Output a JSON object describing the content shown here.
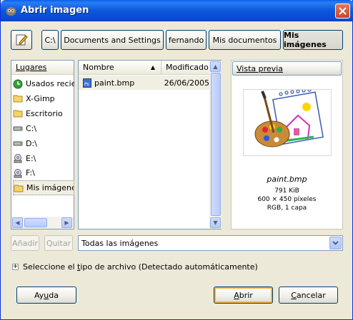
{
  "window": {
    "title": "Abrir imagen"
  },
  "path_bar": {
    "segments": [
      "C:\\",
      "Documents and Settings",
      "fernando",
      "Mis documentos",
      "Mis imágenes"
    ],
    "active": "Mis imágenes"
  },
  "places": {
    "header": "Lugares",
    "items": [
      {
        "label": "Usados recientemente",
        "icon": "recent-icon"
      },
      {
        "label": "X-Gimp",
        "icon": "folder-icon"
      },
      {
        "label": "Escritorio",
        "icon": "folder-icon"
      },
      {
        "label": "C:\\",
        "icon": "drive-icon"
      },
      {
        "label": "D:\\",
        "icon": "drive-icon"
      },
      {
        "label": "E:\\",
        "icon": "cdrom-icon"
      },
      {
        "label": "F:\\",
        "icon": "cdrom-icon"
      },
      {
        "label": "Mis imágenes",
        "icon": "folder-icon"
      }
    ],
    "add_label": "Añadir",
    "remove_label": "Quitar"
  },
  "files": {
    "col_name": "Nombre",
    "col_modified": "Modificado",
    "rows": [
      {
        "name": "paint.bmp",
        "modified": "26/06/2005"
      }
    ]
  },
  "preview": {
    "header": "Vista previa",
    "filename": "paint.bmp",
    "size": "791 KiB",
    "dimensions": "600 × 450 píxeles",
    "mode": "RGB, 1 capa"
  },
  "filter": {
    "value": "Todas las imágenes"
  },
  "file_type": {
    "label_pre": "Seleccione el ",
    "label_key": "t",
    "label_post": "ipo de archivo (Detectado automáticamente)"
  },
  "buttons": {
    "help": {
      "pre": "Ay",
      "key": "u",
      "post": "da"
    },
    "open": {
      "pre": "",
      "key": "A",
      "post": "brir"
    },
    "cancel": {
      "pre": "",
      "key": "C",
      "post": "ancelar"
    }
  },
  "colors": {
    "titlebar": "#0a5fe8",
    "selection": "#f1efe2",
    "accent_border": "#003c74"
  }
}
